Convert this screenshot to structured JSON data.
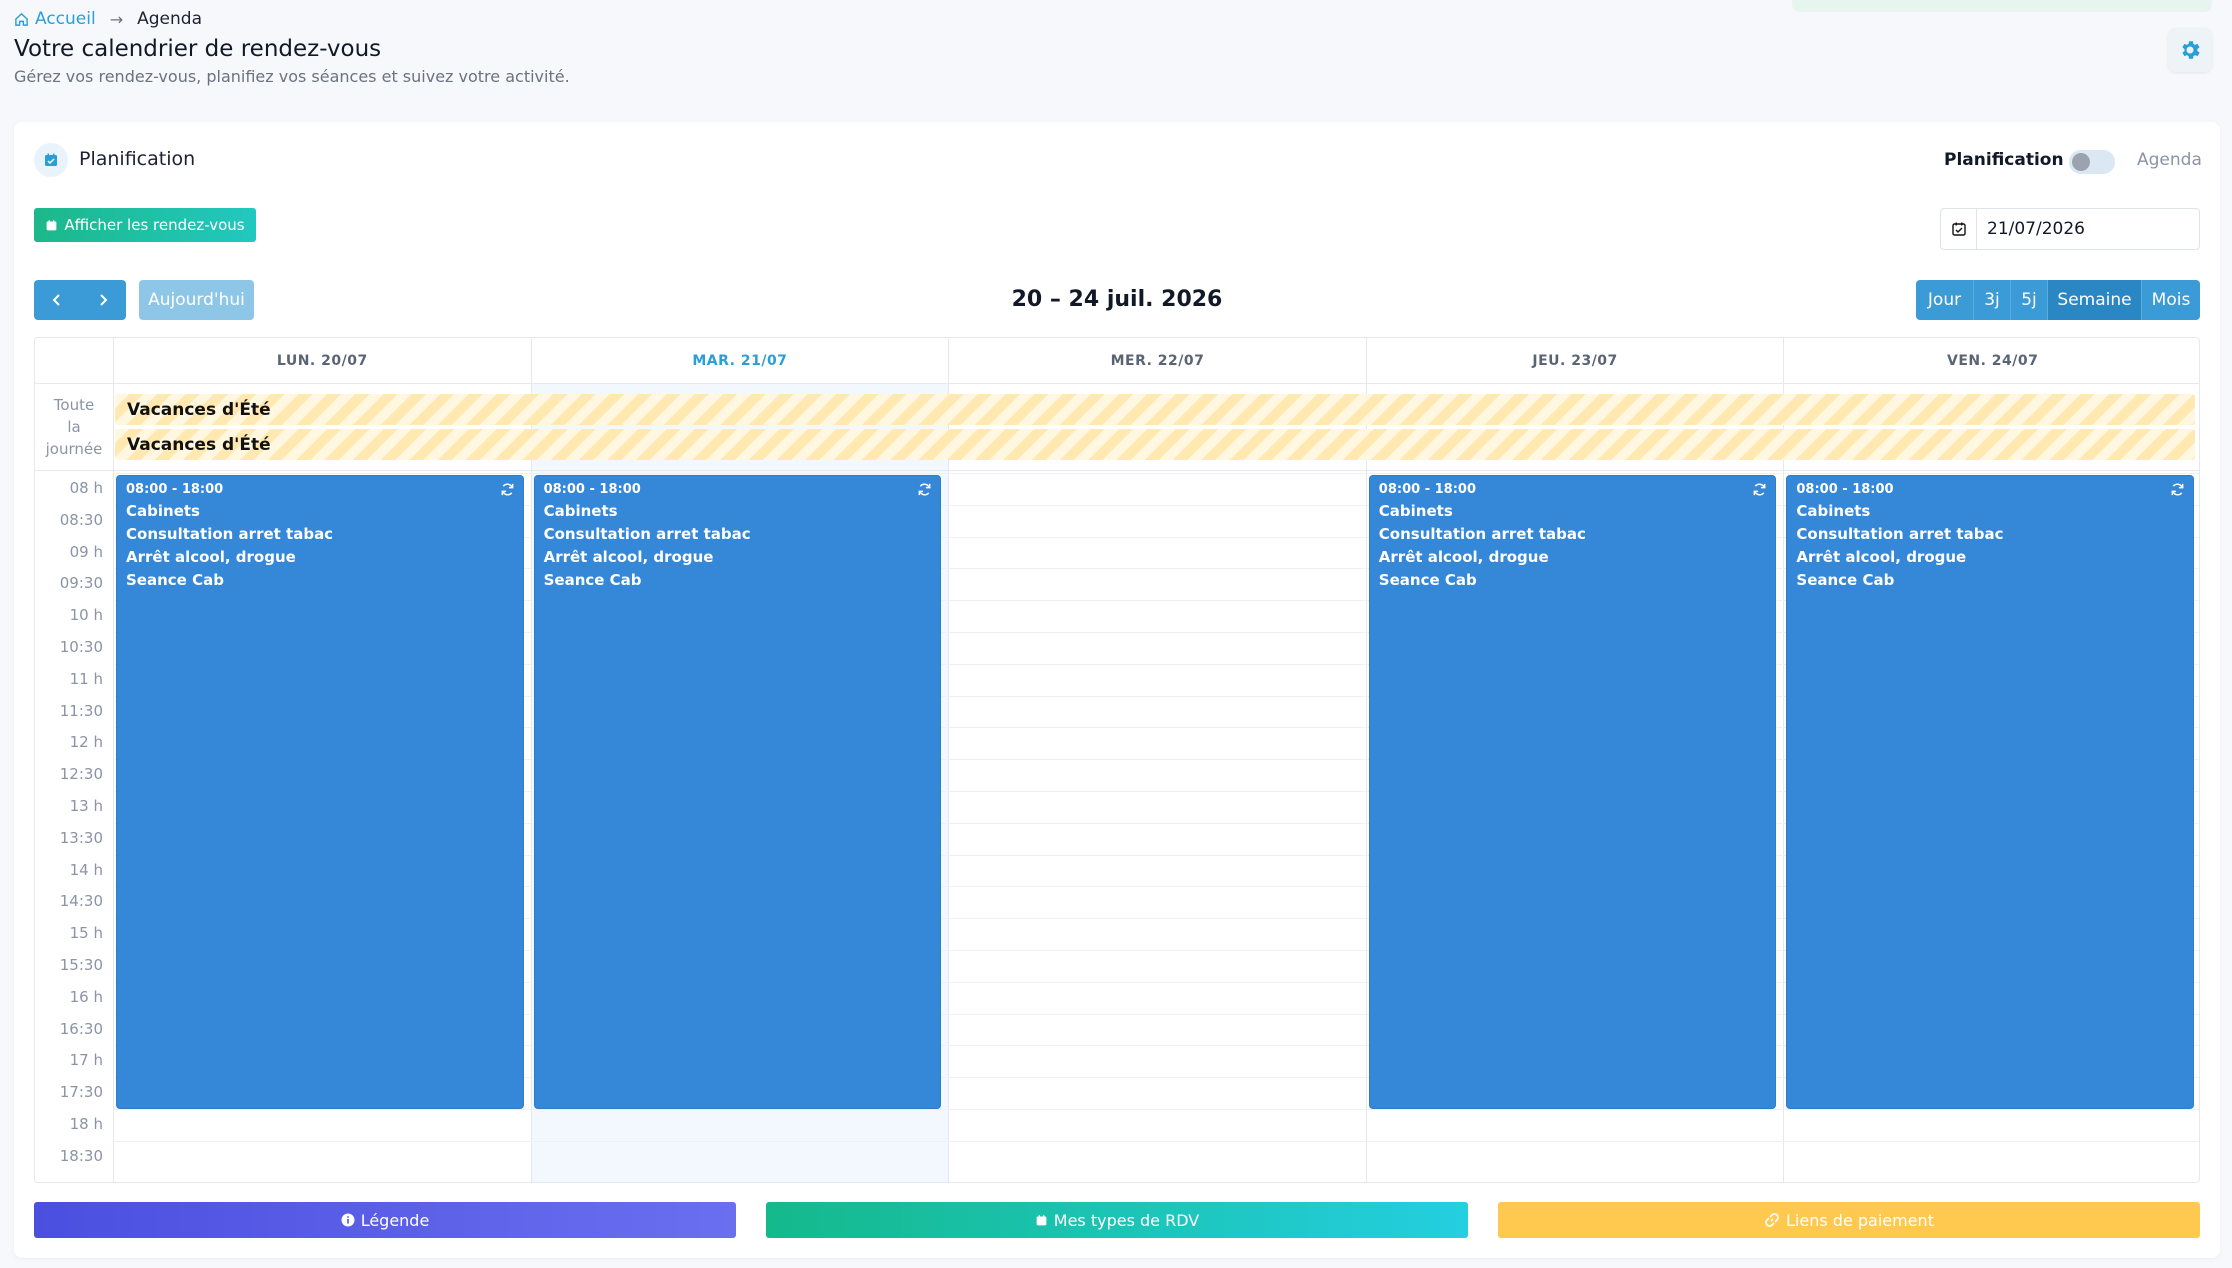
{
  "breadcrumb": {
    "home": "Accueil",
    "current": "Agenda"
  },
  "header": {
    "title": "Votre calendrier de rendez-vous",
    "subtitle": "Gérez vos rendez-vous, planifiez vos séances et suivez votre activité."
  },
  "card": {
    "title": "Planification",
    "toggle_left": "Planification",
    "toggle_right": "Agenda",
    "toggle_on": false,
    "show_rdv_label": "Afficher les rendez-vous",
    "date_value": "21/07/2026"
  },
  "toolbar": {
    "today_label": "Aujourd'hui",
    "range_title": "20 – 24 juil. 2026",
    "views": [
      "Jour",
      "3j",
      "5j",
      "Semaine",
      "Mois"
    ],
    "active_view": "Semaine"
  },
  "calendar": {
    "days": [
      "LUN. 20/07",
      "MAR. 21/07",
      "MER. 22/07",
      "JEU. 23/07",
      "VEN. 24/07"
    ],
    "today_index": 1,
    "allday_label": [
      "Toute",
      "la",
      "journée"
    ],
    "allday_events": [
      "Vacances d'Été",
      "Vacances d'Été"
    ],
    "time_slots": [
      "08 h",
      "08:30",
      "09 h",
      "09:30",
      "10 h",
      "10:30",
      "11 h",
      "11:30",
      "12 h",
      "12:30",
      "13 h",
      "13:30",
      "14 h",
      "14:30",
      "15 h",
      "15:30",
      "16 h",
      "16:30",
      "17 h",
      "17:30",
      "18 h",
      "18:30"
    ],
    "events": [
      {
        "day": 0,
        "time": "08:00 - 18:00",
        "lines": [
          "Cabinets",
          "Consultation arret tabac",
          "Arrêt alcool, drogue",
          "Seance Cab"
        ]
      },
      {
        "day": 1,
        "time": "08:00 - 18:00",
        "lines": [
          "Cabinets",
          "Consultation arret tabac",
          "Arrêt alcool, drogue",
          "Seance Cab"
        ]
      },
      {
        "day": 3,
        "time": "08:00 - 18:00",
        "lines": [
          "Cabinets",
          "Consultation arret tabac",
          "Arrêt alcool, drogue",
          "Seance Cab"
        ]
      },
      {
        "day": 4,
        "time": "08:00 - 18:00",
        "lines": [
          "Cabinets",
          "Consultation arret tabac",
          "Arrêt alcool, drogue",
          "Seance Cab"
        ]
      }
    ],
    "event_color": "#3587d8"
  },
  "footer": {
    "legend_label": "Légende",
    "types_label": "Mes types de RDV",
    "payment_label": "Liens de paiement"
  },
  "icons": [
    "home-icon",
    "arrow-right-icon",
    "gear-icon",
    "calendar-check-icon",
    "chevron-left-icon",
    "chevron-right-icon",
    "repeat-icon",
    "info-icon",
    "link-icon"
  ],
  "colors": {
    "primary": "#3b9bd6",
    "accent_green": "#1cb88a",
    "legend": "#4b4fdf",
    "payment": "#ffc94f"
  }
}
